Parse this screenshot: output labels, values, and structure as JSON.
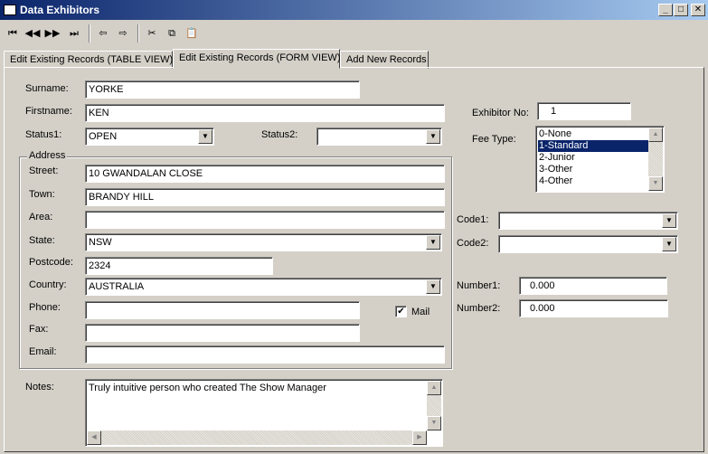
{
  "window": {
    "title": "Data Exhibitors",
    "minimize": "_",
    "maximize": "□",
    "close": "✕"
  },
  "toolbar": {
    "first": "⏮",
    "prev": "◀◀",
    "next": "▶▶",
    "last": "⏭",
    "back": "⇦",
    "forward": "⇨",
    "cut": "✂",
    "copy": "⧉",
    "paste": "📋"
  },
  "tabs": [
    {
      "label": "Edit Existing Records (TABLE VIEW)"
    },
    {
      "label": "Edit Existing Records (FORM VIEW)"
    },
    {
      "label": "Add New Records"
    }
  ],
  "form": {
    "surname": {
      "label": "Surname:",
      "value": "YORKE"
    },
    "firstname": {
      "label": "Firstname:",
      "value": "KEN"
    },
    "status1": {
      "label": "Status1:",
      "value": "OPEN"
    },
    "status2": {
      "label": "Status2:",
      "value": ""
    },
    "exhibitor_no": {
      "label": "Exhibitor No:",
      "value": "1"
    },
    "fee_type": {
      "label": "Fee Type:",
      "options": [
        "0-None",
        "1-Standard",
        "2-Junior",
        "3-Other",
        "4-Other"
      ],
      "selected": "1-Standard"
    },
    "address_group": "Address",
    "street": {
      "label": "Street:",
      "value": "10 GWANDALAN CLOSE"
    },
    "town": {
      "label": "Town:",
      "value": "BRANDY HILL"
    },
    "area": {
      "label": "Area:",
      "value": ""
    },
    "state": {
      "label": "State:",
      "value": "NSW"
    },
    "postcode": {
      "label": "Postcode:",
      "value": "2324"
    },
    "country": {
      "label": "Country:",
      "value": "AUSTRALIA"
    },
    "phone": {
      "label": "Phone:",
      "value": ""
    },
    "fax": {
      "label": "Fax:",
      "value": ""
    },
    "email": {
      "label": "Email:",
      "value": ""
    },
    "mail": {
      "label": "Mail",
      "checked": true,
      "check_glyph": "✔"
    },
    "code1": {
      "label": "Code1:",
      "value": ""
    },
    "code2": {
      "label": "Code2:",
      "value": ""
    },
    "number1": {
      "label": "Number1:",
      "value": "0.000"
    },
    "number2": {
      "label": "Number2:",
      "value": "0.000"
    },
    "notes": {
      "label": "Notes:",
      "value": "Truly intuitive person who created The Show Manager"
    }
  }
}
